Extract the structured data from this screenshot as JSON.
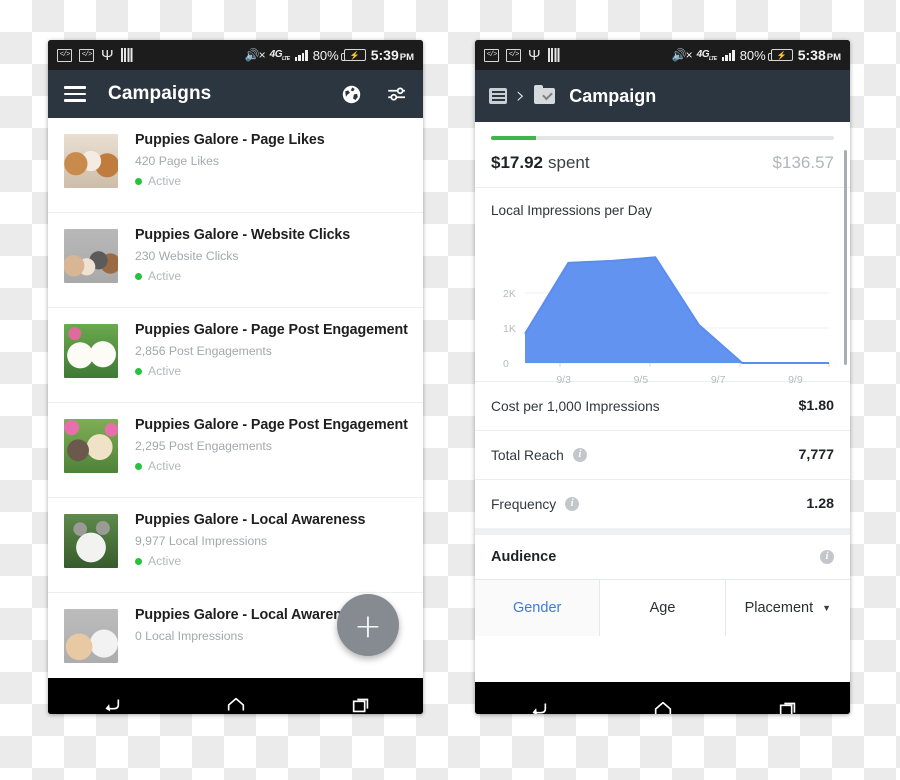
{
  "left_phone": {
    "status_bar": {
      "icons": [
        "code-box-icon",
        "code-box-icon",
        "usb-icon",
        "sim-card-icon"
      ],
      "mute_icon": "volume-mute-icon",
      "network": "4G LTE",
      "network_label": "4G",
      "network_sub": "LTE",
      "signal_icon": "signal-bars-icon",
      "battery_pct": "80%",
      "battery_icon": "battery-charging-icon",
      "time": "5:39",
      "meridiem": "PM"
    },
    "app_bar": {
      "menu_icon": "hamburger-menu-icon",
      "title": "Campaigns",
      "globe_icon": "globe-icon",
      "tune_icon": "tune-sliders-icon"
    },
    "campaigns": [
      {
        "title": "Puppies Galore - Page Likes",
        "metric": "420 Page Likes",
        "status": "Active",
        "thumb": "puppies-thumbnail-1"
      },
      {
        "title": "Puppies Galore - Website Clicks",
        "metric": "230 Website Clicks",
        "status": "Active",
        "thumb": "puppies-thumbnail-2"
      },
      {
        "title": "Puppies Galore - Page Post Engagement",
        "metric": "2,856 Post Engagements",
        "status": "Active",
        "thumb": "puppies-thumbnail-3"
      },
      {
        "title": "Puppies Galore - Page Post Engagement",
        "metric": "2,295 Post Engagements",
        "status": "Active",
        "thumb": "puppies-thumbnail-4"
      },
      {
        "title": "Puppies Galore - Local Awareness",
        "metric": "9,977 Local Impressions",
        "status": "Active",
        "thumb": "puppies-thumbnail-5"
      },
      {
        "title": "Puppies Galore - Local Awareness",
        "metric": "0 Local Impressions",
        "status": "",
        "thumb": "puppies-thumbnail-6"
      }
    ],
    "fab": {
      "label": "+",
      "name": "add-campaign-fab"
    },
    "nav_bar": {
      "back": "back-icon",
      "home": "home-icon",
      "recents": "recents-icon"
    },
    "colors": {
      "appbar": "#2c3640",
      "status_active": "#27c23c",
      "fab": "#858b91"
    }
  },
  "right_phone": {
    "status_bar": {
      "network_label": "4G",
      "network_sub": "LTE",
      "battery_pct": "80%",
      "time": "5:38",
      "meridiem": "PM"
    },
    "breadcrumb": {
      "list_icon": "list-icon",
      "separator": "›",
      "folder_icon": "folder-check-icon",
      "title": "Campaign"
    },
    "spend": {
      "progress_pct": 13,
      "amount": "$17.92",
      "label": "spent",
      "total": "$136.57",
      "progress_color": "#3cb54a"
    },
    "metrics": [
      {
        "label": "Cost per 1,000 Impressions",
        "value": "$1.80",
        "info": false
      },
      {
        "label": "Total Reach",
        "value": "7,777",
        "info": true
      },
      {
        "label": "Frequency",
        "value": "1.28",
        "info": true
      }
    ],
    "audience": {
      "heading": "Audience",
      "info_icon": "info-icon",
      "tabs": [
        {
          "label": "Gender",
          "selected": true,
          "caret": false
        },
        {
          "label": "Age",
          "selected": false,
          "caret": false
        },
        {
          "label": "Placement",
          "selected": false,
          "caret": true
        }
      ]
    },
    "nav_bar": {
      "back": "back-icon",
      "home": "home-icon",
      "recents": "recents-icon"
    }
  },
  "chart_data": {
    "type": "area",
    "title": "Local Impressions per Day",
    "xlabel": "",
    "ylabel": "",
    "x": [
      "9/2",
      "9/3",
      "9/4",
      "9/5",
      "9/6",
      "9/7",
      "9/8",
      "9/9"
    ],
    "tick_labels": [
      "9/3",
      "9/5",
      "9/7",
      "9/9"
    ],
    "values": [
      800,
      2750,
      2800,
      2900,
      1050,
      0,
      0,
      0
    ],
    "ytick_labels": [
      "0",
      "1K",
      "2K"
    ],
    "yticks": [
      0,
      1000,
      2000
    ],
    "ylim": [
      0,
      3100
    ],
    "grid": true,
    "legend": "none",
    "series_color": "#5b8def",
    "axis_label_color": "#b6bbc0"
  }
}
